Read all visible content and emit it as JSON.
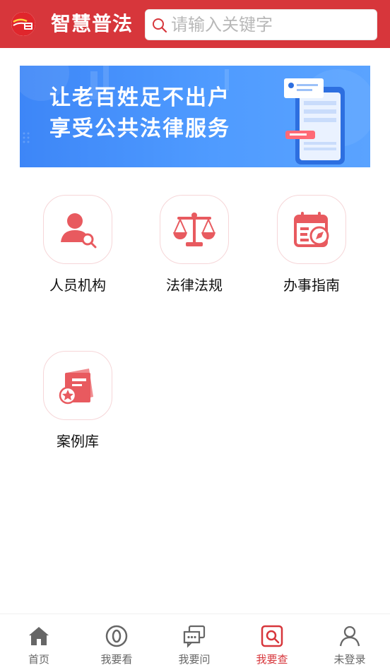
{
  "header": {
    "app_title": "智慧普法",
    "search_placeholder": "请输入关键字"
  },
  "banner": {
    "line1": "让老百姓足不出户",
    "line2": "享受公共法律服务"
  },
  "grid": [
    {
      "label": "人员机构",
      "icon": "person-search-icon"
    },
    {
      "label": "法律法规",
      "icon": "scales-icon"
    },
    {
      "label": "办事指南",
      "icon": "calendar-compass-icon"
    },
    {
      "label": "案例库",
      "icon": "case-book-icon"
    }
  ],
  "tabs": [
    {
      "label": "首页",
      "icon": "home-icon",
      "active": false
    },
    {
      "label": "我要看",
      "icon": "eye-icon",
      "active": false
    },
    {
      "label": "我要问",
      "icon": "chat-icon",
      "active": false
    },
    {
      "label": "我要查",
      "icon": "search-doc-icon",
      "active": true
    },
    {
      "label": "未登录",
      "icon": "user-icon",
      "active": false
    }
  ],
  "colors": {
    "primary": "#d7363b",
    "banner_blue": "#4f9bff",
    "icon_red": "#e85a5f",
    "tab_inactive": "#666666"
  }
}
